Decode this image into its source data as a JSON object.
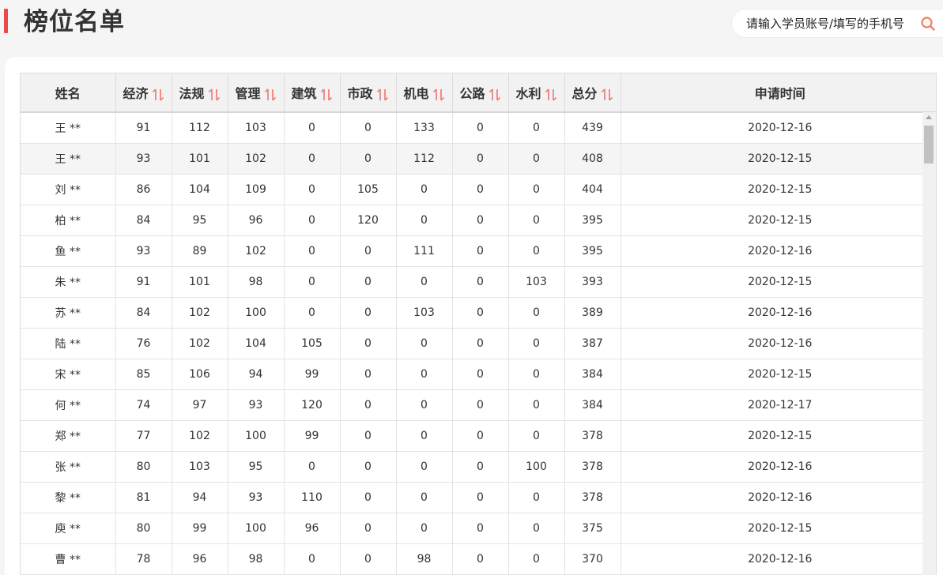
{
  "page": {
    "title": "榜位名单"
  },
  "search": {
    "placeholder": "请输入学员账号/填写的手机号",
    "icon": "search-icon",
    "icon_color": "#f08060"
  },
  "colors": {
    "accent": "#e84a4a",
    "sort_icon": "#f08080"
  },
  "table": {
    "headers": [
      "姓名",
      "经济",
      "法规",
      "管理",
      "建筑",
      "市政",
      "机电",
      "公路",
      "水利",
      "总分",
      "申请时间"
    ],
    "sortable": [
      false,
      true,
      true,
      true,
      true,
      true,
      true,
      true,
      true,
      true,
      false
    ],
    "rows": [
      [
        "王 **",
        "91",
        "112",
        "103",
        "0",
        "0",
        "133",
        "0",
        "0",
        "439",
        "2020-12-16"
      ],
      [
        "王 **",
        "93",
        "101",
        "102",
        "0",
        "0",
        "112",
        "0",
        "0",
        "408",
        "2020-12-15"
      ],
      [
        "刘 **",
        "86",
        "104",
        "109",
        "0",
        "105",
        "0",
        "0",
        "0",
        "404",
        "2020-12-15"
      ],
      [
        "柏 **",
        "84",
        "95",
        "96",
        "0",
        "120",
        "0",
        "0",
        "0",
        "395",
        "2020-12-15"
      ],
      [
        "鱼 **",
        "93",
        "89",
        "102",
        "0",
        "0",
        "111",
        "0",
        "0",
        "395",
        "2020-12-16"
      ],
      [
        "朱 **",
        "91",
        "101",
        "98",
        "0",
        "0",
        "0",
        "0",
        "103",
        "393",
        "2020-12-15"
      ],
      [
        "苏 **",
        "84",
        "102",
        "100",
        "0",
        "0",
        "103",
        "0",
        "0",
        "389",
        "2020-12-16"
      ],
      [
        "陆 **",
        "76",
        "102",
        "104",
        "105",
        "0",
        "0",
        "0",
        "0",
        "387",
        "2020-12-16"
      ],
      [
        "宋 **",
        "85",
        "106",
        "94",
        "99",
        "0",
        "0",
        "0",
        "0",
        "384",
        "2020-12-15"
      ],
      [
        "何 **",
        "74",
        "97",
        "93",
        "120",
        "0",
        "0",
        "0",
        "0",
        "384",
        "2020-12-17"
      ],
      [
        "郑 **",
        "77",
        "102",
        "100",
        "99",
        "0",
        "0",
        "0",
        "0",
        "378",
        "2020-12-15"
      ],
      [
        "张 **",
        "80",
        "103",
        "95",
        "0",
        "0",
        "0",
        "0",
        "100",
        "378",
        "2020-12-16"
      ],
      [
        "黎 **",
        "81",
        "94",
        "93",
        "110",
        "0",
        "0",
        "0",
        "0",
        "378",
        "2020-12-16"
      ],
      [
        "庾 **",
        "80",
        "99",
        "100",
        "96",
        "0",
        "0",
        "0",
        "0",
        "375",
        "2020-12-15"
      ],
      [
        "曹 **",
        "78",
        "96",
        "98",
        "0",
        "0",
        "98",
        "0",
        "0",
        "370",
        "2020-12-16"
      ]
    ]
  }
}
